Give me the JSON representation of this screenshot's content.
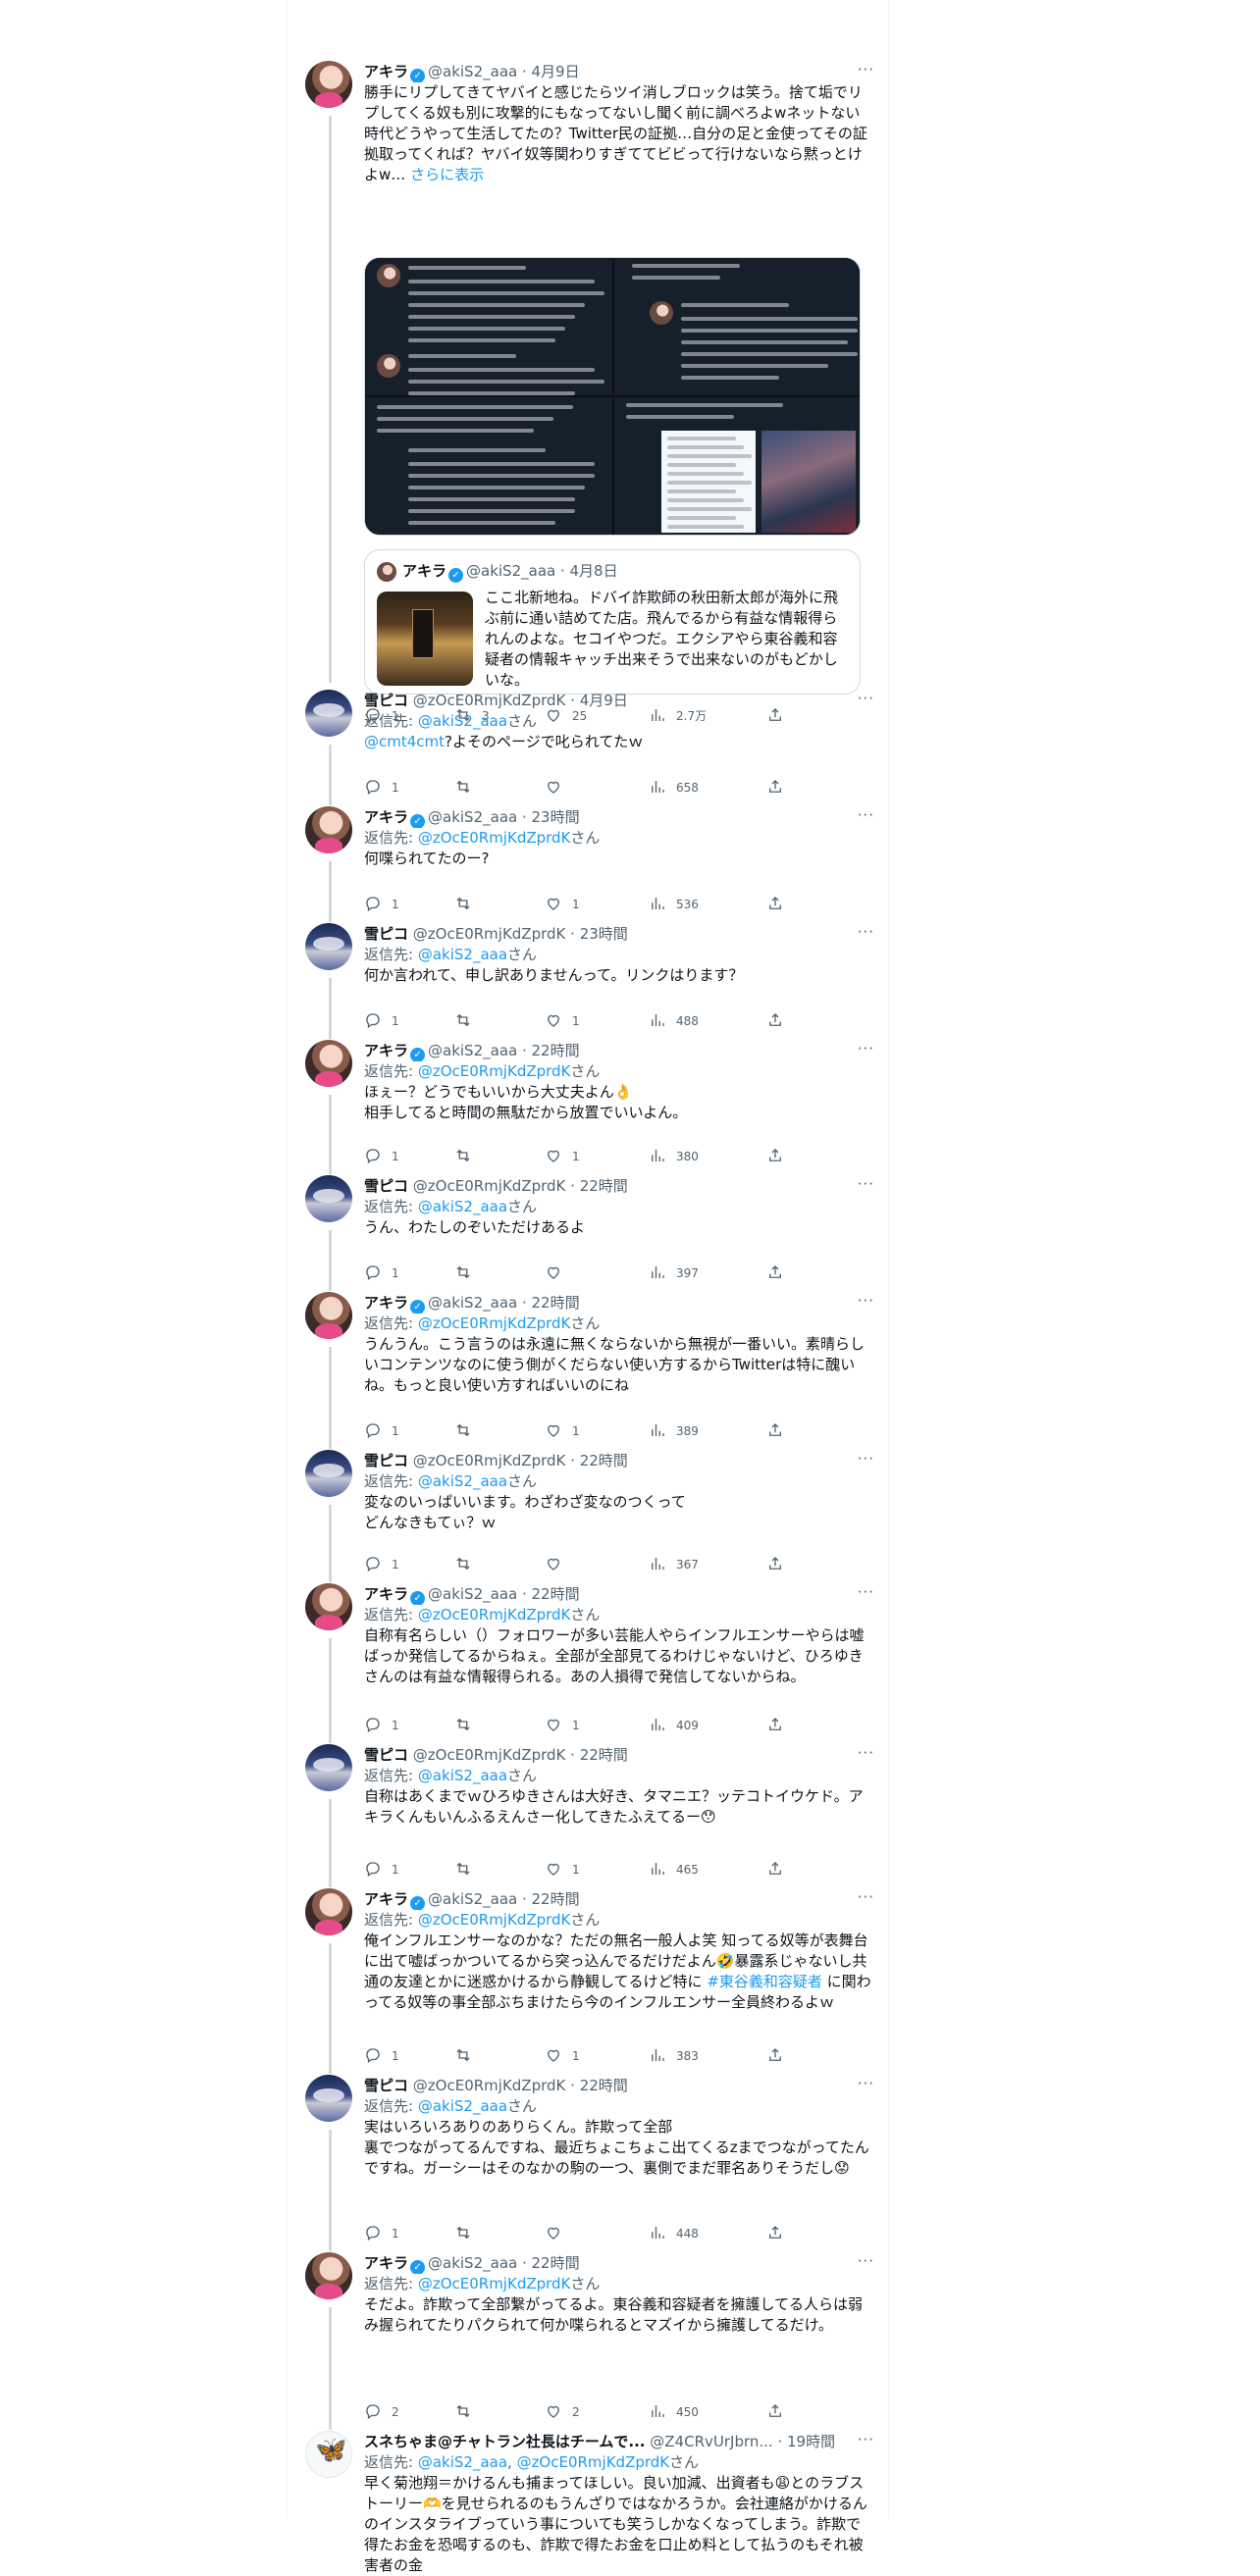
{
  "labels": {
    "reply_prefix": "返信先: ",
    "reply_suffix": "さん",
    "more": "···",
    "sep": " · ",
    "show_more": "さらに表示",
    "verified": "✓"
  },
  "main": {
    "name": "アキラ",
    "handle": "@akiS2_aaa",
    "time": "4月9日",
    "text": "勝手にリプしてきてヤバイと感じたらツイ消しブロックは笑う。捨て垢でリプしてくる奴も別に攻撃的にもなってないし聞く前に調べろよwネットない時代どうやって生活してたの？Twitter民の証拠…自分の足と金使ってその証拠取ってくれば？ヤバイ奴等関わりすぎててビビって行けないなら黙っとけよw…",
    "quote": {
      "name": "アキラ",
      "handle": "@akiS2_aaa",
      "time": "4月8日",
      "text": "ここ北新地ね。ドバイ詐欺師の秋田新太郎が海外に飛ぶ前に通い詰めてた店。飛んでるから有益な情報得られんのよな。セコイやつだ。エクシアやら東谷義和容疑者の情報キャッチ出来そうで出来ないのがもどかしいな。"
    },
    "stats": {
      "replies": "1",
      "retweets": "3",
      "likes": "25",
      "views": "2.7万"
    }
  },
  "tweets": [
    {
      "name": "雪ピコ",
      "handle": "@zOcE0RmjKdZprdK",
      "time": "4月9日",
      "verified": false,
      "reply_to": [
        "@akiS2_aaa"
      ],
      "mention": "@cmt4cmt",
      "text": "?よそのページで叱られてたｗ",
      "stats": {
        "replies": "1",
        "retweets": "",
        "likes": "",
        "views": "658"
      }
    },
    {
      "name": "アキラ",
      "handle": "@akiS2_aaa",
      "time": "23時間",
      "verified": true,
      "reply_to": [
        "@zOcE0RmjKdZprdK"
      ],
      "text": "何喋られてたのー?",
      "stats": {
        "replies": "1",
        "retweets": "",
        "likes": "1",
        "views": "536"
      }
    },
    {
      "name": "雪ピコ",
      "handle": "@zOcE0RmjKdZprdK",
      "time": "23時間",
      "verified": false,
      "reply_to": [
        "@akiS2_aaa"
      ],
      "text": "何か言われて、申し訳ありませんって。リンクはります？",
      "stats": {
        "replies": "1",
        "retweets": "",
        "likes": "1",
        "views": "488"
      }
    },
    {
      "name": "アキラ",
      "handle": "@akiS2_aaa",
      "time": "22時間",
      "verified": true,
      "reply_to": [
        "@zOcE0RmjKdZprdK"
      ],
      "text": "ほぇー？どうでもいいから大丈夫よん👌\n相手してると時間の無駄だから放置でいいよん。",
      "stats": {
        "replies": "1",
        "retweets": "",
        "likes": "1",
        "views": "380"
      }
    },
    {
      "name": "雪ピコ",
      "handle": "@zOcE0RmjKdZprdK",
      "time": "22時間",
      "verified": false,
      "reply_to": [
        "@akiS2_aaa"
      ],
      "text": "うん、わたしのぞいただけあるよ",
      "stats": {
        "replies": "1",
        "retweets": "",
        "likes": "",
        "views": "397"
      }
    },
    {
      "name": "アキラ",
      "handle": "@akiS2_aaa",
      "time": "22時間",
      "verified": true,
      "reply_to": [
        "@zOcE0RmjKdZprdK"
      ],
      "text": "うんうん。こう言うのは永遠に無くならないから無視が一番いい。素晴らしいコンテンツなのに使う側がくだらない使い方するからTwitterは特に醜いね。もっと良い使い方すればいいのにね",
      "stats": {
        "replies": "1",
        "retweets": "",
        "likes": "1",
        "views": "389"
      }
    },
    {
      "name": "雪ピコ",
      "handle": "@zOcE0RmjKdZprdK",
      "time": "22時間",
      "verified": false,
      "reply_to": [
        "@akiS2_aaa"
      ],
      "text": "変なのいっぱいいます。わざわざ変なのつくって\nどんなきもてぃ？ｗ",
      "stats": {
        "replies": "1",
        "retweets": "",
        "likes": "",
        "views": "367"
      }
    },
    {
      "name": "アキラ",
      "handle": "@akiS2_aaa",
      "time": "22時間",
      "verified": true,
      "reply_to": [
        "@zOcE0RmjKdZprdK"
      ],
      "text": "自称有名らしい（）フォロワーが多い芸能人やらインフルエンサーやらは嘘ばっか発信してるからねぇ。全部が全部見てるわけじゃないけど、ひろゆきさんのは有益な情報得られる。あの人損得で発信してないからね。",
      "stats": {
        "replies": "1",
        "retweets": "",
        "likes": "1",
        "views": "409"
      }
    },
    {
      "name": "雪ピコ",
      "handle": "@zOcE0RmjKdZprdK",
      "time": "22時間",
      "verified": false,
      "reply_to": [
        "@akiS2_aaa"
      ],
      "text": "自称はあくまでｗひろゆきさんは大好き、タマニエ？ッテコトイウケド。アキラくんもいんふるえんさー化してきたふえてるー😯",
      "stats": {
        "replies": "1",
        "retweets": "",
        "likes": "1",
        "views": "465"
      }
    },
    {
      "name": "アキラ",
      "handle": "@akiS2_aaa",
      "time": "22時間",
      "verified": true,
      "reply_to": [
        "@zOcE0RmjKdZprdK"
      ],
      "text": "俺インフルエンサーなのかな？ただの無名一般人よ笑 知ってる奴等が表舞台に出て嘘ばっかついてるから突っ込んでるだけだよん🤣暴露系じゃないし共通の友達とかに迷惑かけるから静観してるけど特に ",
      "hashtag": "#東谷義和容疑者",
      "text2": " に関わってる奴等の事全部ぶちまけたら今のインフルエンサー全員終わるよｗ",
      "stats": {
        "replies": "1",
        "retweets": "",
        "likes": "1",
        "views": "383"
      }
    },
    {
      "name": "雪ピコ",
      "handle": "@zOcE0RmjKdZprdK",
      "time": "22時間",
      "verified": false,
      "reply_to": [
        "@akiS2_aaa"
      ],
      "text": "実はいろいろありのありらくん。詐欺って全部\n裏でつながってるんですね、最近ちょこちょこ出てくるzまでつながってたんですね。ガーシーはそのなかの駒の一つ、裏側でまだ罪名ありそうだし😟",
      "stats": {
        "replies": "1",
        "retweets": "",
        "likes": "",
        "views": "448"
      }
    },
    {
      "name": "アキラ",
      "handle": "@akiS2_aaa",
      "time": "22時間",
      "verified": true,
      "reply_to": [
        "@zOcE0RmjKdZprdK"
      ],
      "text": "そだよ。詐欺って全部繋がってるよ。東谷義和容疑者を擁護してる人らは弱み握られてたりパクられて何か喋られるとマズイから擁護してるだけ。",
      "stats": {
        "replies": "2",
        "retweets": "",
        "likes": "2",
        "views": "450"
      }
    },
    {
      "name": "スネちゃま@チャトラン社長はチームで...",
      "handle": "@Z4CRvUrJbrn...",
      "time": "19時間",
      "verified": false,
      "reply_to": [
        "@akiS2_aaa",
        "@zOcE0RmjKdZprdK"
      ],
      "text": "早く菊池翔＝かけるんも捕まってほしい。良い加減、出資者も😩とのラブストーリー🫶を見せられるのもうんざりではなかろうか。会社連絡がかけるんのインスタライブっていう事についても笑うしかなくなってしまう。詐欺で得たお金を恐喝するのも、詐欺で得たお金を口止め料として払うのもそれ被害者の金",
      "stats": {
        "replies": "",
        "retweets": "",
        "likes": "",
        "views": ""
      }
    }
  ]
}
